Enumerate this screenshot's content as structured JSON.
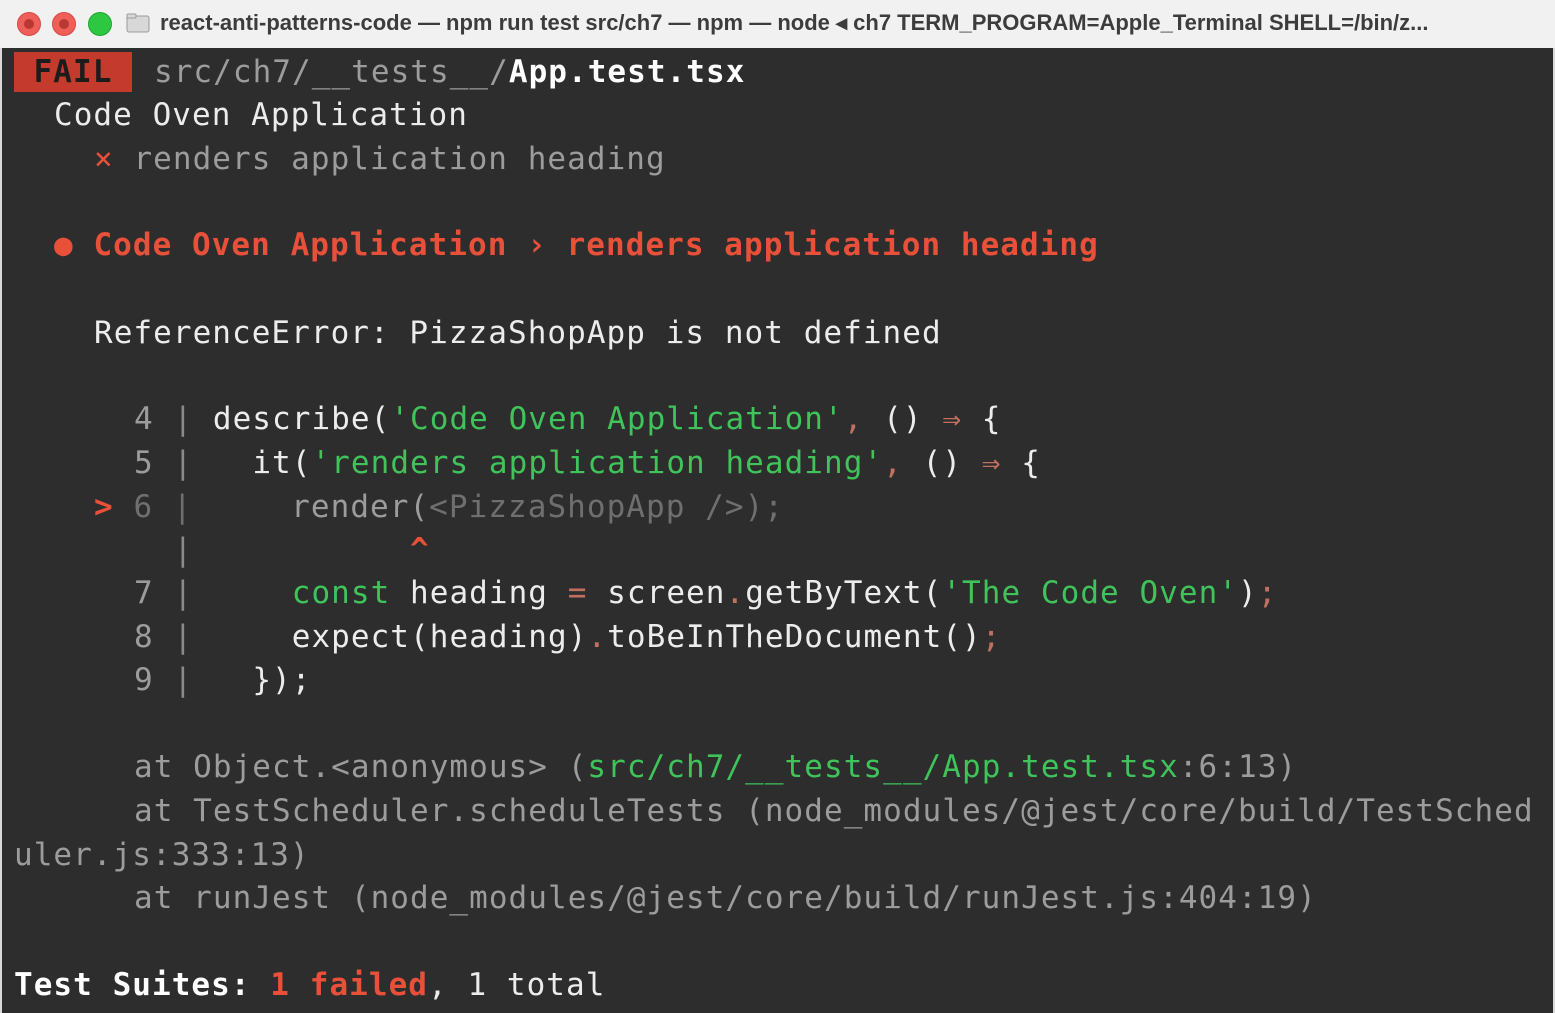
{
  "window": {
    "title": "react-anti-patterns-code — npm run test src/ch7 — npm — node ◂ ch7 TERM_PROGRAM=Apple_Terminal SHELL=/bin/z..."
  },
  "colors": {
    "fail_badge": "#c43a2c",
    "error_red": "#e8503a",
    "string_green": "#3fc35a",
    "background": "#2d2d2d"
  },
  "terminal": {
    "fail_label": "FAIL",
    "test_path_dir": "src/ch7/__tests__/",
    "test_path_file": "App.test.tsx",
    "suite_name": "Code Oven Application",
    "fail_mark": "×",
    "test_name": "renders application heading",
    "error_bullet": "●",
    "error_header_suite": "Code Oven Application",
    "error_header_sep": "›",
    "error_header_test": "renders application heading",
    "error_message": "ReferenceError: PizzaShopApp is not defined",
    "code_lines": {
      "l4_num": "4",
      "l4_a": "describe(",
      "l4_str": "'Code Oven Application'",
      "l4_b": ", ",
      "l4_c": "() ",
      "l4_arrow": "⇒",
      "l4_d": " {",
      "l5_num": "5",
      "l5_a": "it(",
      "l5_str": "'renders application heading'",
      "l5_b": ", ",
      "l5_c": "() ",
      "l5_arrow": "⇒",
      "l5_d": " {",
      "l6_marker": ">",
      "l6_num": "6",
      "l6_a": "render(",
      "l6_jsx": "<PizzaShopApp />",
      "l6_b": ");",
      "caret": "^",
      "l7_num": "7",
      "l7_kw": "const",
      "l7_a": " heading ",
      "l7_eq": "=",
      "l7_b": " screen",
      "l7_dot": ".",
      "l7_c": "getByText(",
      "l7_str": "'The Code Oven'",
      "l7_d": ")",
      "l7_semi": ";",
      "l8_num": "8",
      "l8_a": "expect(heading)",
      "l8_dot": ".",
      "l8_b": "toBeInTheDocument()",
      "l8_semi": ";",
      "l9_num": "9",
      "l9_a": "});",
      "bar": "|"
    },
    "stack": {
      "s1_a": "at Object.<anonymous> (",
      "s1_path": "src/ch7/__tests__/App.test.tsx",
      "s1_b": ":6:13)",
      "s2_a": "at TestScheduler.scheduleTests (node_modules/@jest/core/build/TestSched",
      "s2_b": "uler.js:333:13)",
      "s3_a": "at runJest (node_modules/@jest/core/build/runJest.js:404:19)"
    },
    "summary": {
      "label": "Test Suites:",
      "failed": "1 failed",
      "rest": ", 1 total"
    }
  }
}
